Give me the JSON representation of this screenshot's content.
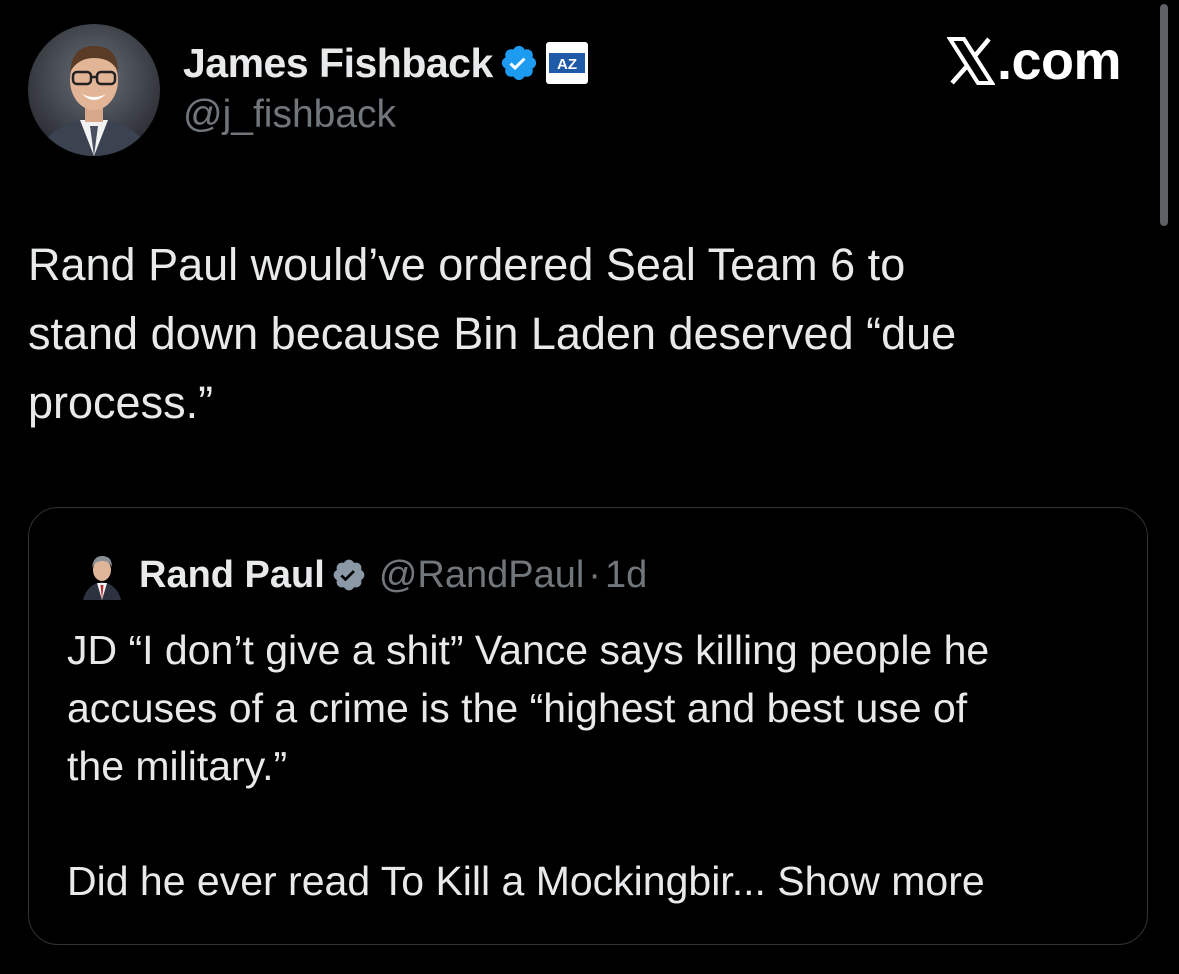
{
  "author": {
    "name": "James Fishback",
    "handle": "@j_fishback",
    "avatar_icon": "user-portrait-icon",
    "verified_icon": "verified-badge-icon",
    "affiliate_badge": {
      "icon": "az-affiliate-badge-icon",
      "text": "AZ"
    }
  },
  "brand": {
    "icon": "x-logo-icon",
    "text": ".com"
  },
  "tweet": {
    "lines": [
      "Rand Paul would’ve ordered Seal Team 6 to",
      "stand down because Bin Laden deserved “due",
      "process.”"
    ]
  },
  "quote": {
    "name": "Rand Paul",
    "handle": "@RandPaul",
    "separator": "·",
    "time": "1d",
    "avatar_icon": "user-portrait-icon",
    "verified_icon": "verified-badge-icon",
    "lines": [
      "JD “I don’t give a shit” Vance says killing people he",
      "accuses of a crime is the “highest and best use of",
      "the military.”"
    ],
    "last_line": "Did he ever read To Kill a Mockingbir...",
    "show_more": "Show more"
  },
  "colors": {
    "background": "#000000",
    "text": "#e7e9ea",
    "secondary": "#71767b",
    "verified": "#1d9bf0",
    "border": "#2f3336"
  }
}
